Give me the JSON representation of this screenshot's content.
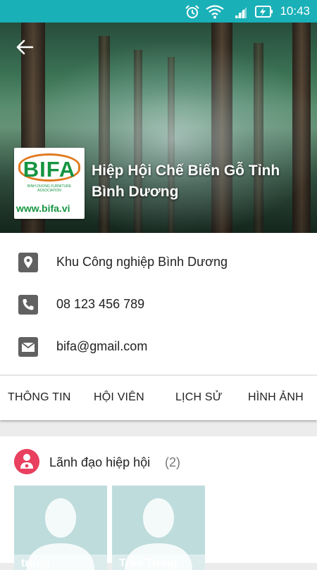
{
  "status_bar": {
    "time": "10:43"
  },
  "header": {
    "title": "Hiệp Hội Chế Biến Gỗ Tỉnh Bình Dương",
    "logo": {
      "brand": "BIFA",
      "subtitle": "BINH DUONG FURNITURE ASSOCIATION",
      "url": "www.bifa.vi"
    }
  },
  "info": {
    "address": "Khu Công nghiệp Bình Dương",
    "phone": "08 123 456 789",
    "email": "bifa@gmail.com"
  },
  "tabs": [
    {
      "label": "THÔNG TIN"
    },
    {
      "label": "HỘI VIÊN"
    },
    {
      "label": "LỊCH SỬ"
    },
    {
      "label": "HÌNH ẢNH"
    }
  ],
  "section": {
    "title": "Lãnh đạo hiệp hội",
    "count": "(2)",
    "members": [
      {
        "name": "trung"
      },
      {
        "name": "Trần Trung"
      }
    ]
  },
  "colors": {
    "status_bar": "#1ab0b8",
    "accent": "#e8405e",
    "logo_green": "#159441",
    "logo_orange": "#e07a1f"
  }
}
